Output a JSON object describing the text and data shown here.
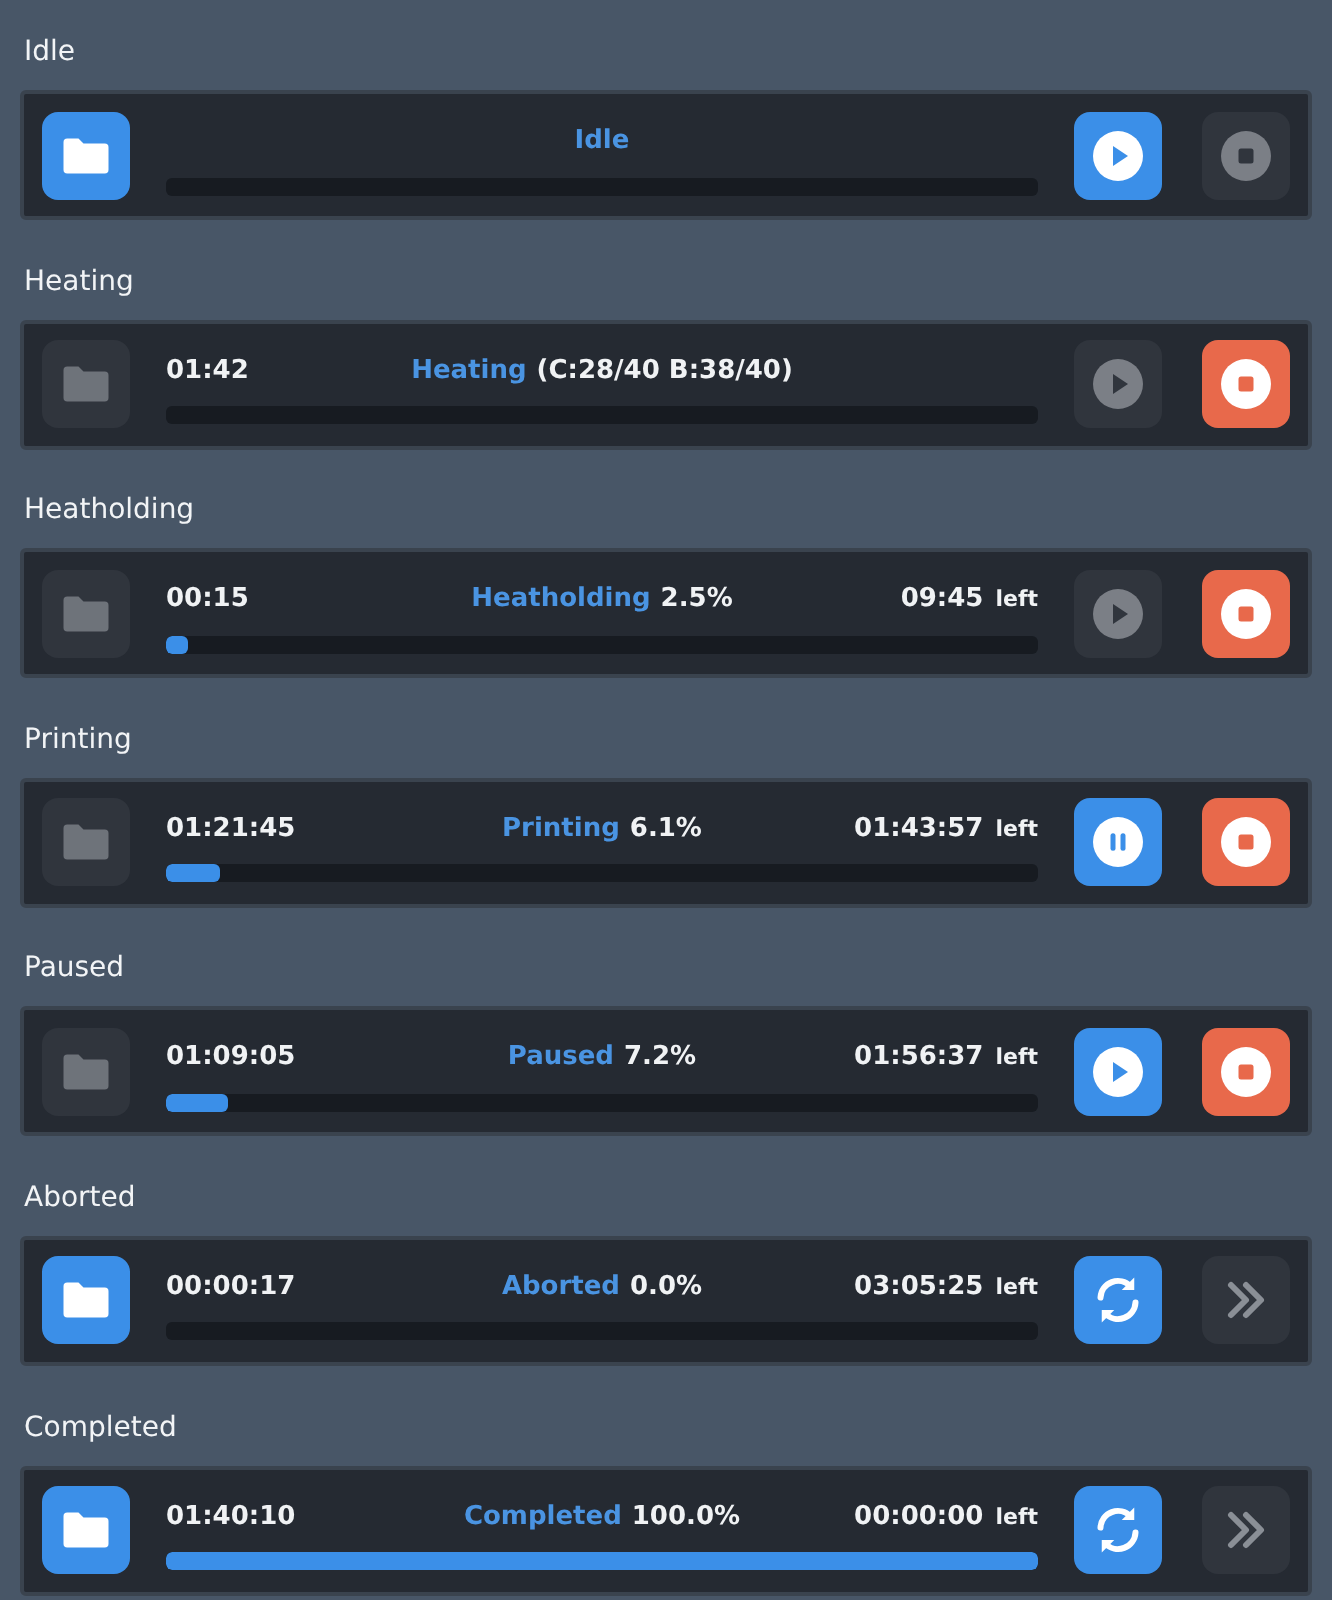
{
  "sections": [
    {
      "label": "Idle",
      "card": {
        "folder_enabled": true,
        "status": "Idle",
        "level": 0,
        "primary": {
          "kind": "play",
          "enabled": true
        },
        "secondary": {
          "kind": "stop",
          "enabled": false
        }
      }
    },
    {
      "label": "Heating",
      "card": {
        "folder_enabled": false,
        "elapsed": "01:42",
        "status": "Heating",
        "detail": "(C:28/40 B:38/40)",
        "level": 0,
        "primary": {
          "kind": "play",
          "enabled": false
        },
        "secondary": {
          "kind": "stop",
          "enabled": true
        }
      }
    },
    {
      "label": "Heatholding",
      "card": {
        "folder_enabled": false,
        "elapsed": "00:15",
        "status": "Heatholding",
        "detail": "2.5%",
        "remaining": "09:45",
        "remaining_suffix": "left",
        "level": 0.025,
        "primary": {
          "kind": "play",
          "enabled": false
        },
        "secondary": {
          "kind": "stop",
          "enabled": true
        }
      }
    },
    {
      "label": "Printing",
      "card": {
        "folder_enabled": false,
        "elapsed": "01:21:45",
        "status": "Printing",
        "detail": "6.1%",
        "remaining": "01:43:57",
        "remaining_suffix": "left",
        "level": 0.061,
        "primary": {
          "kind": "pause",
          "enabled": true
        },
        "secondary": {
          "kind": "stop",
          "enabled": true
        }
      }
    },
    {
      "label": "Paused",
      "card": {
        "folder_enabled": false,
        "elapsed": "01:09:05",
        "status": "Paused",
        "detail": "7.2%",
        "remaining": "01:56:37",
        "remaining_suffix": "left",
        "level": 0.072,
        "primary": {
          "kind": "play",
          "enabled": true
        },
        "secondary": {
          "kind": "stop",
          "enabled": true
        }
      }
    },
    {
      "label": "Aborted",
      "card": {
        "folder_enabled": true,
        "elapsed": "00:00:17",
        "status": "Aborted",
        "detail": "0.0%",
        "remaining": "03:05:25",
        "remaining_suffix": "left",
        "level": 0,
        "primary": {
          "kind": "restart",
          "enabled": true
        },
        "secondary": {
          "kind": "skip",
          "enabled": false
        }
      }
    },
    {
      "label": "Completed",
      "card": {
        "folder_enabled": true,
        "elapsed": "01:40:10",
        "status": "Completed",
        "detail": "100.0%",
        "remaining": "00:00:00",
        "remaining_suffix": "left",
        "level": 1,
        "primary": {
          "kind": "restart",
          "enabled": true
        },
        "secondary": {
          "kind": "skip",
          "enabled": false
        }
      }
    }
  ]
}
